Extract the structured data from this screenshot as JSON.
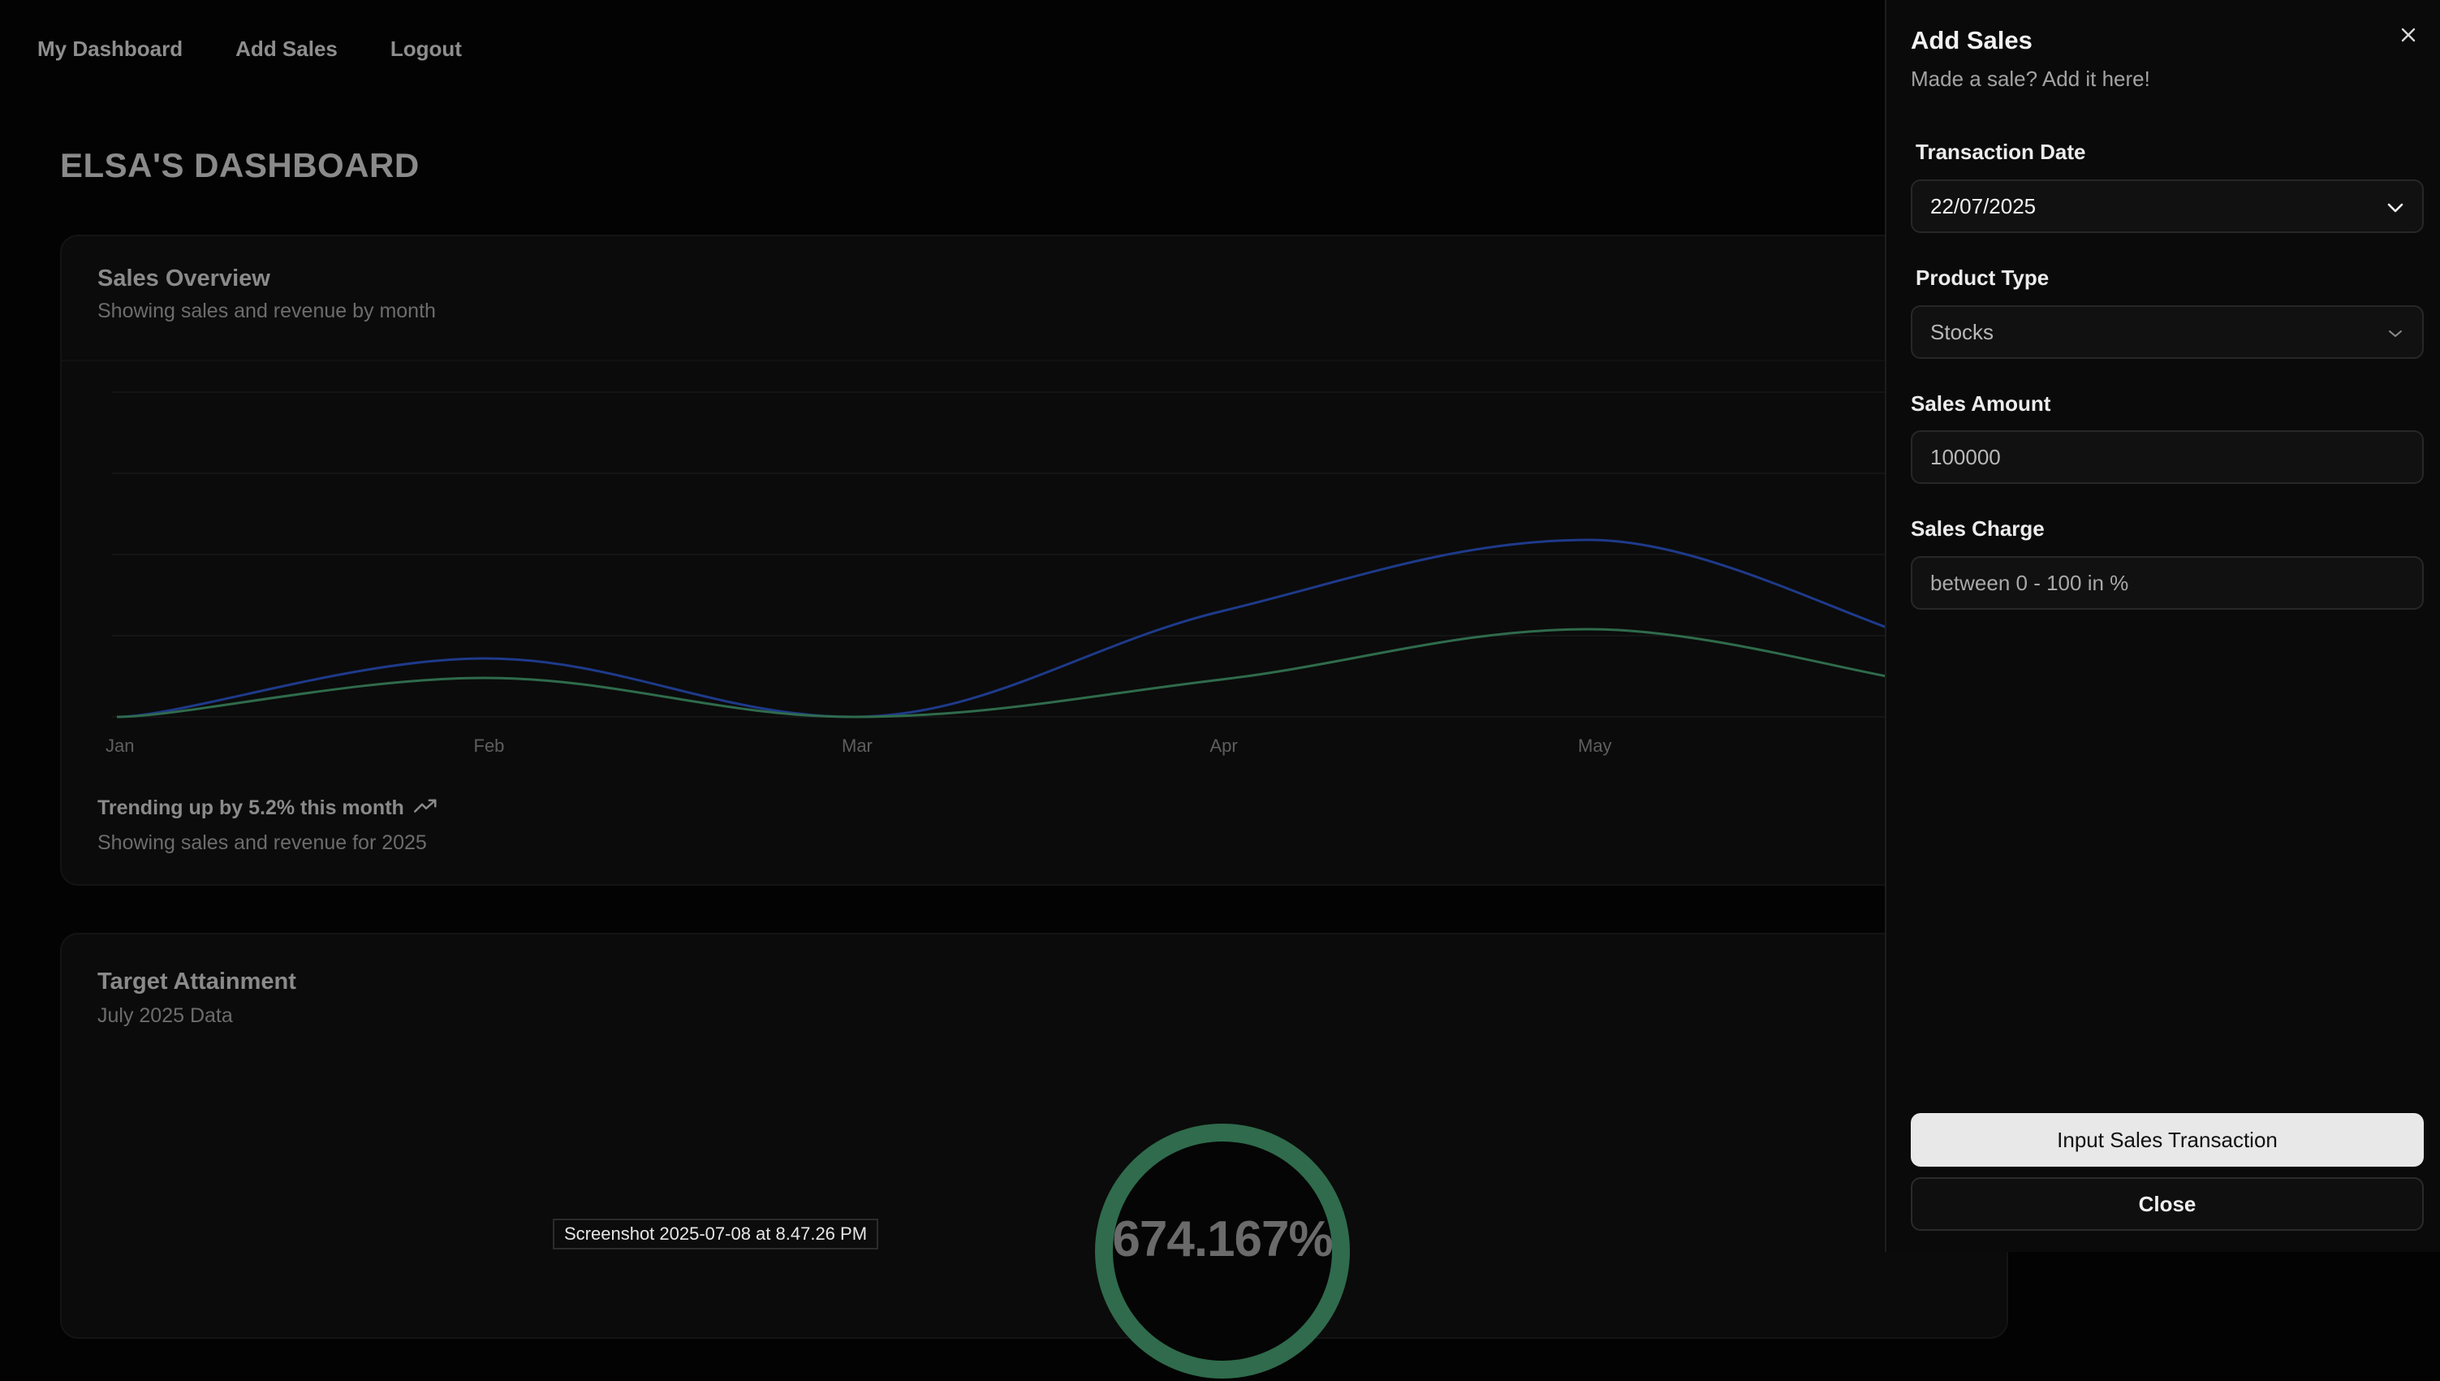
{
  "nav": {
    "items": [
      "My Dashboard",
      "Add Sales",
      "Logout"
    ]
  },
  "page": {
    "title": "ELSA'S DASHBOARD"
  },
  "sales_card": {
    "title": "Sales Overview",
    "subtitle": "Showing sales and revenue by month",
    "trend_text": "Trending up by 5.2% this month",
    "trend_icon": "trending-up-icon",
    "footer_text": "Showing sales and revenue for 2025"
  },
  "chart_data": {
    "type": "line",
    "categories": [
      "Jan",
      "Feb",
      "Mar",
      "Apr",
      "May"
    ],
    "series": [
      {
        "color": "#1e3a8a",
        "values": [
          0,
          72,
          0,
          130,
          218
        ]
      },
      {
        "color": "#2f6b4c",
        "values": [
          0,
          48,
          0,
          46,
          108
        ]
      }
    ],
    "ylim": [
      0,
      440
    ],
    "grid": true
  },
  "target_card": {
    "title": "Target Attainment",
    "subtitle": "July 2025 Data",
    "gauge_value": "674.167%",
    "gauge_color": "#2f6b4c"
  },
  "overlay": {
    "screenshot_label": "Screenshot 2025-07-08 at 8.47.26 PM"
  },
  "drawer": {
    "title": "Add Sales",
    "subtitle": "Made a sale? Add it here!",
    "transaction_date_label": "Transaction Date",
    "transaction_date_value": "22/07/2025",
    "product_type_label": "Product Type",
    "product_type_value": "Stocks",
    "sales_amount_label": "Sales Amount",
    "sales_amount_value": "100000",
    "sales_charge_label": "Sales Charge",
    "sales_charge_placeholder": "between 0 - 100 in %",
    "submit_label": "Input Sales Transaction",
    "close_label": "Close"
  }
}
